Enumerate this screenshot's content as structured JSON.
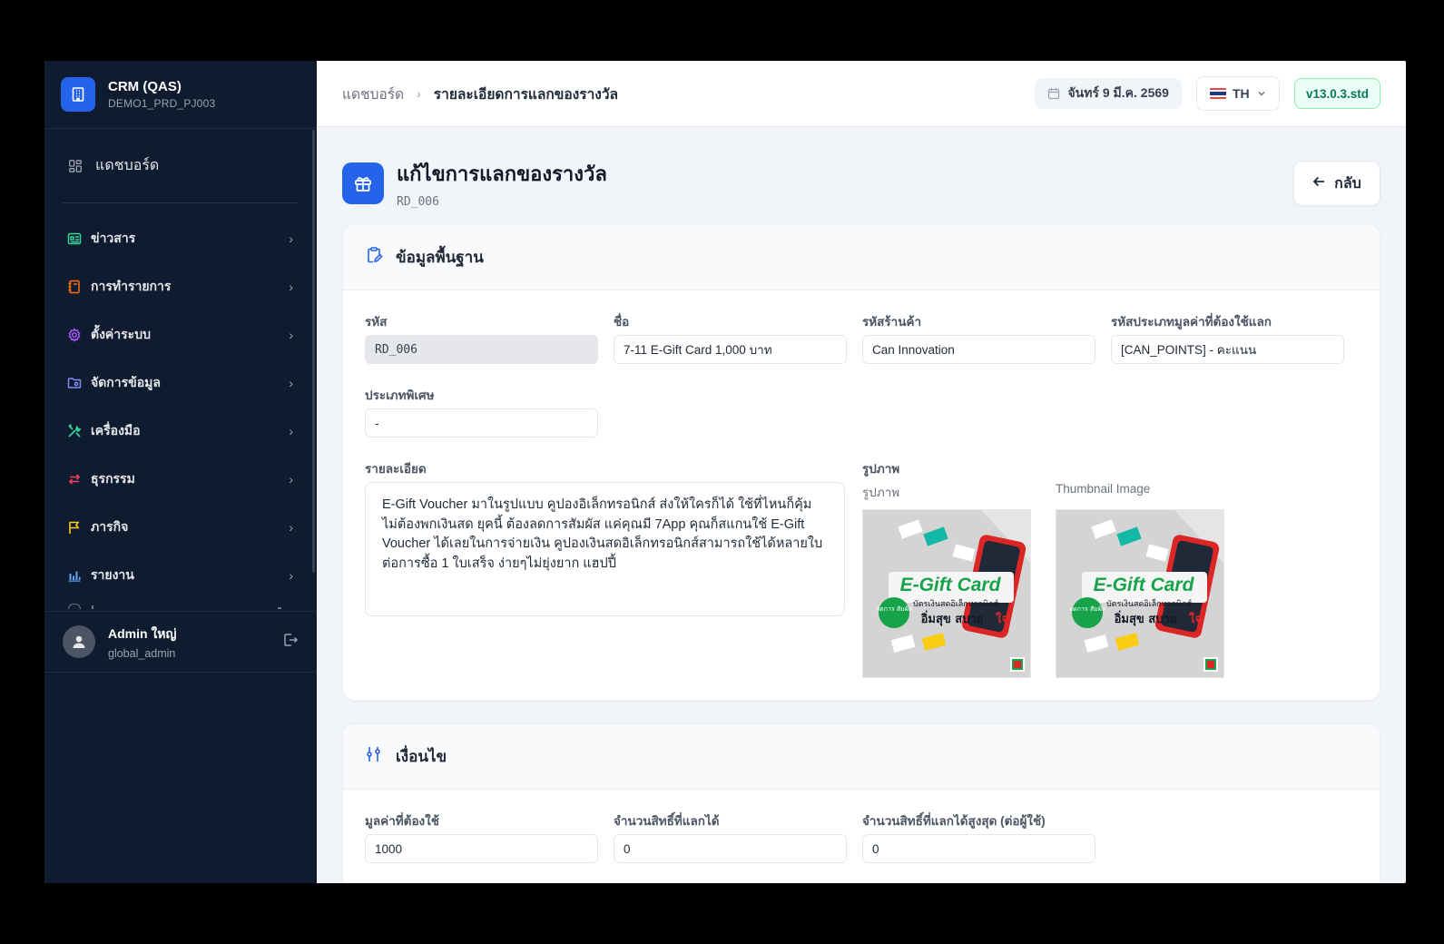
{
  "app": {
    "title": "CRM (QAS)",
    "subtitle": "DEMO1_PRD_PJ003"
  },
  "sidebar": {
    "dashboard": "แดชบอร์ด",
    "items": [
      {
        "label": "ข่าวสาร",
        "icon": "newspaper-icon",
        "color": "#34d399"
      },
      {
        "label": "การทำรายการ",
        "icon": "notebook-icon",
        "color": "#f97316"
      },
      {
        "label": "ตั้งค่าระบบ",
        "icon": "gear-icon",
        "color": "#a855f7"
      },
      {
        "label": "จัดการข้อมูล",
        "icon": "folder-icon",
        "color": "#818cf8"
      },
      {
        "label": "เครื่องมือ",
        "icon": "tools-icon",
        "color": "#34d399"
      },
      {
        "label": "ธุรกรรม",
        "icon": "arrows-exchange-icon",
        "color": "#f43f5e"
      },
      {
        "label": "ภารกิจ",
        "icon": "flag-icon",
        "color": "#facc15"
      },
      {
        "label": "รายงาน",
        "icon": "bar-chart-icon",
        "color": "#60a5fa"
      }
    ]
  },
  "user": {
    "name": "Admin ใหญ่",
    "role": "global_admin"
  },
  "topbar": {
    "breadcrumb_home": "แดชบอร์ด",
    "breadcrumb_current": "รายละเอียดการแลกของรางวัล",
    "date": "จันทร์ 9 มี.ค. 2569",
    "language": "TH",
    "version": "v13.0.3.std"
  },
  "page": {
    "title": "แก้ไขการแลกของรางวัล",
    "code": "RD_006",
    "back_label": "กลับ"
  },
  "basic_info": {
    "title": "ข้อมูลพื้นฐาน",
    "code_label": "รหัส",
    "code_value": "RD_006",
    "name_label": "ชื่อ",
    "name_value": "7-11 E-Gift Card 1,000 บาท",
    "shop_label": "รหัสร้านค้า",
    "shop_value": "Can Innovation",
    "value_type_label": "รหัสประเภทมูลค่าที่ต้องใช้แลก",
    "value_type_value": "[CAN_POINTS] - คะแนน",
    "special_label": "ประเภทพิเศษ",
    "special_value": "-",
    "detail_label": "รายละเอียด",
    "detail_value": "E-Gift Voucher มาในรูปแบบ คูปองอิเล็กทรอนิกส์ ส่งให้ใครก็ได้ ใช้ที่ไหนก็คุ้ม ไม่ต้องพกเงินสด ยุคนี้ ต้องลดการสัมผัส แค่คุณมี 7App คุณก็สแกนใช้ E-Gift Voucher ได้เลยในการจ่ายเงิน คูปองเงินสดอิเล็กทรอนิกส์สามารถใช้ได้หลายใบต่อการซื้อ 1 ใบเสร็จ ง่ายๆไม่ยุ่งยาก แฮปปี้",
    "images_label": "รูปภาพ",
    "image_sub_label": "รูปภาพ",
    "thumb_sub_label": "Thumbnail Image",
    "card_image": {
      "title": "E-Gift Card",
      "line1": "บัตรเงินสดอิเล็กทรอนิกส์",
      "line2": "อิ่มสุข สบาย",
      "line2_accent": "ใจ",
      "badge": "ลดการ สัมผัส"
    }
  },
  "conditions": {
    "title": "เงื่อนไข",
    "required_value_label": "มูลค่าที่ต้องใช้",
    "required_value": "1000",
    "quota_label": "จำนวนสิทธิ์ที่แลกได้",
    "quota_value": "0",
    "max_per_user_label": "จำนวนสิทธิ์ที่แลกได้สูงสุด (ต่อผู้ใช้)",
    "max_per_user_value": "0"
  },
  "colors": {
    "primary": "#2563eb",
    "sidebar_bg": "#0f1b2e",
    "version_green": "#047857"
  }
}
